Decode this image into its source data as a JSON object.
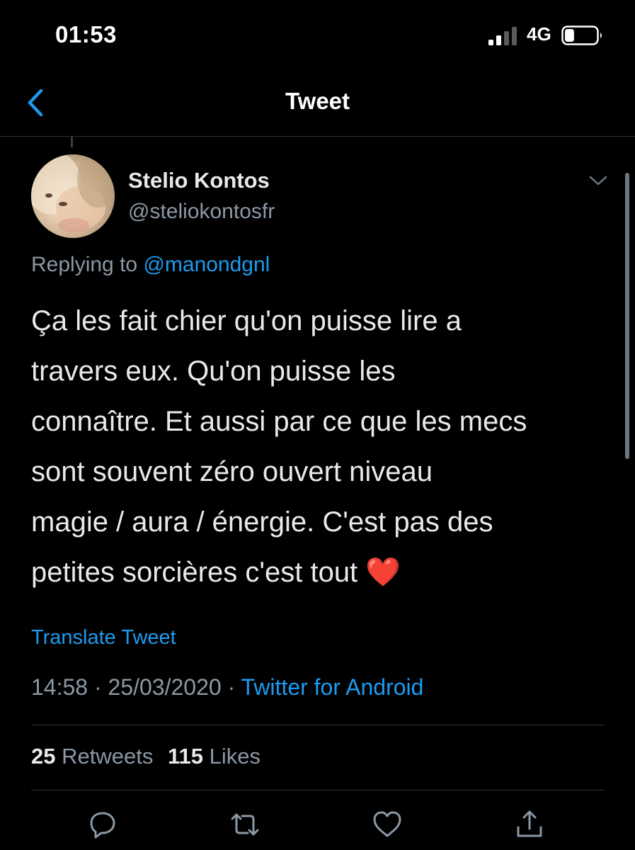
{
  "status_bar": {
    "time": "01:53",
    "network": "4G",
    "signal_bars": 2,
    "battery_level": 0.3,
    "icons": [
      "signal-icon",
      "battery-icon"
    ]
  },
  "nav": {
    "title": "Tweet",
    "back_icon": "chevron-left-icon"
  },
  "tweet": {
    "author": {
      "name": "Stelio Kontos",
      "handle": "@steliokontosfr"
    },
    "replying_prefix": "Replying to",
    "replying_to": "@manondgnl",
    "body_lines": [
      "Ça les fait chier qu'on puisse lire a",
      "travers eux. Qu'on puisse les",
      "connaître. Et aussi par ce que les mecs",
      "sont souvent zéro ouvert niveau",
      "magie / aura / énergie. C'est pas des",
      "petites sorcières c'est tout"
    ],
    "emoji": "❤️",
    "translate": "Translate Tweet",
    "time": "14:58",
    "separator": " · ",
    "date": "25/03/2020",
    "source": "Twitter for Android",
    "retweets_count": "25",
    "retweets_label": "Retweets",
    "likes_count": "115",
    "likes_label": "Likes"
  },
  "actions": [
    "reply-icon",
    "retweet-icon",
    "like-icon",
    "share-icon"
  ],
  "colors": {
    "background": "#000000",
    "link": "#1d9bf0",
    "secondary_text": "#8b98a5",
    "primary_text": "#e7e9ea",
    "divider": "#2f3336"
  }
}
